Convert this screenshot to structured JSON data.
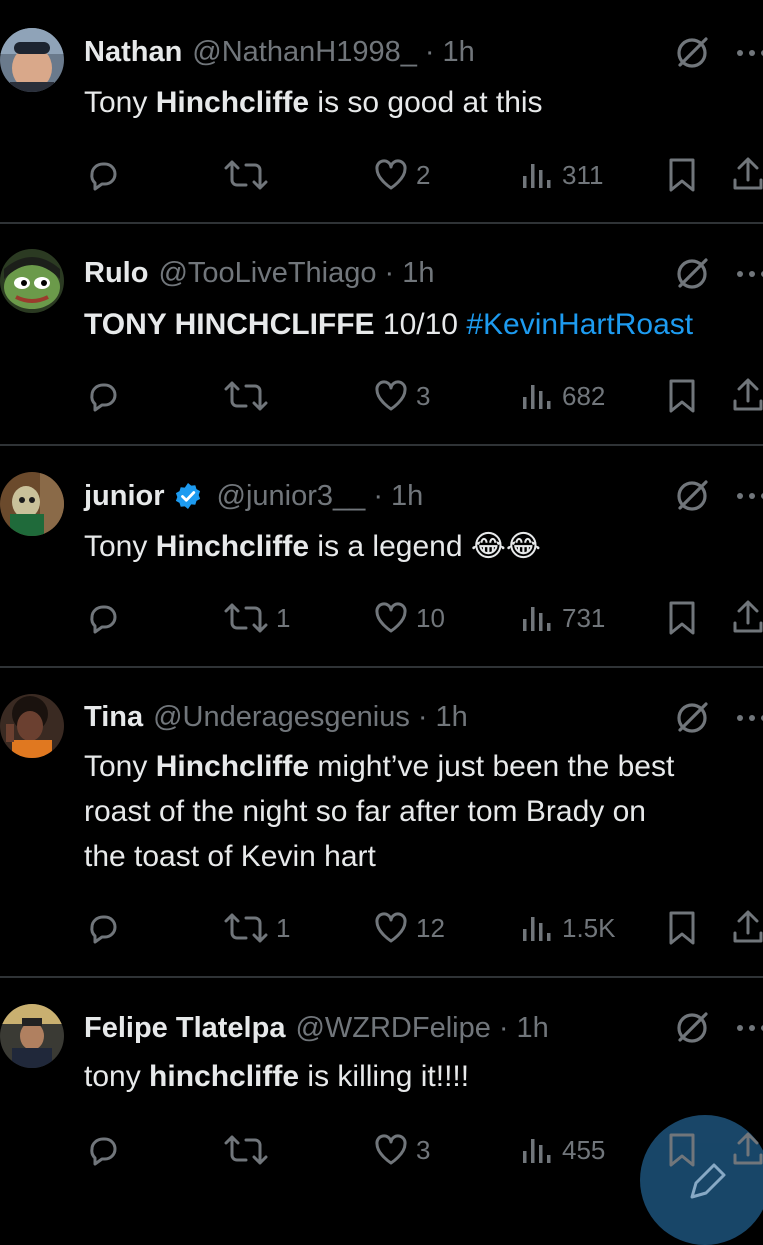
{
  "tweets": [
    {
      "name": "Nathan",
      "handle": "@NathanH1998_",
      "time": "1h",
      "verified": false,
      "text_pre": "Tony ",
      "text_bold": "Hinchcliffe",
      "text_post": " is so good at this",
      "replies": "",
      "retweets": "",
      "likes": "2",
      "views": "311"
    },
    {
      "name": "Rulo",
      "handle": "@TooLiveThiago",
      "time": "1h",
      "verified": false,
      "text_pre": "",
      "text_bold": "TONY HINCHCLIFFE",
      "text_post": " 10/10 ",
      "hashtag": "#KevinHartRoast",
      "replies": "",
      "retweets": "",
      "likes": "3",
      "views": "682"
    },
    {
      "name": "junior",
      "handle": "@junior3__",
      "time": "1h",
      "verified": true,
      "text_pre": "Tony ",
      "text_bold": "Hinchcliffe",
      "text_post": " is a legend ",
      "emoji": "😂😂",
      "replies": "",
      "retweets": "1",
      "likes": "10",
      "views": "731"
    },
    {
      "name": "Tina",
      "handle": "@Underagesgenius",
      "time": "1h",
      "verified": false,
      "text_pre": "Tony ",
      "text_bold": "Hinchcliffe",
      "text_post": " might’ve just been the best",
      "text_line2": "roast of the night so far after tom Brady on",
      "text_line3": "the toast of Kevin hart",
      "replies": "",
      "retweets": "1",
      "likes": "12",
      "views": "1.5K"
    },
    {
      "name": "Felipe Tlatelpa",
      "handle": "@WZRDFelipe",
      "time": "1h",
      "verified": false,
      "text_pre": "tony ",
      "text_bold": "hinchcliffe",
      "text_post": " is killing it!!!!",
      "replies": "",
      "retweets": "",
      "likes": "3",
      "views": "455"
    }
  ],
  "separator": "·",
  "colors": {
    "background": "#000000",
    "text": "#e7e9ea",
    "muted": "#71767b",
    "link": "#1d9bf0",
    "divider": "#2f3336",
    "fab": "#1a4a6e"
  },
  "icons": [
    "reply-icon",
    "retweet-icon",
    "like-icon",
    "views-icon",
    "bookmark-icon",
    "share-icon",
    "grok-icon",
    "more-icon",
    "verified-icon",
    "compose-icon"
  ]
}
